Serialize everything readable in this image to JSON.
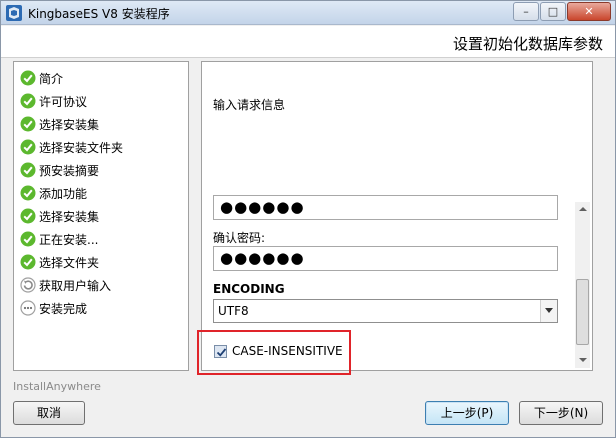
{
  "window": {
    "title": "KingbaseES V8 安装程序",
    "controls": {
      "minimize": "–",
      "maximize": "□",
      "close": "✕"
    }
  },
  "header": {
    "title": "设置初始化数据库参数"
  },
  "steps": [
    {
      "label": "简介",
      "status": "done"
    },
    {
      "label": "许可协议",
      "status": "done"
    },
    {
      "label": "选择安装集",
      "status": "done"
    },
    {
      "label": "选择安装文件夹",
      "status": "done"
    },
    {
      "label": "预安装摘要",
      "status": "done"
    },
    {
      "label": "添加功能",
      "status": "done"
    },
    {
      "label": "选择安装集",
      "status": "done"
    },
    {
      "label": "正在安装...",
      "status": "done"
    },
    {
      "label": "选择文件夹",
      "status": "done"
    },
    {
      "label": "获取用户输入",
      "status": "current"
    },
    {
      "label": "安装完成",
      "status": "pending"
    }
  ],
  "form": {
    "prompt": "输入请求信息",
    "password_mask": "●●●●●●",
    "confirm_label": "确认密码:",
    "confirm_mask": "●●●●●●",
    "encoding_label": "ENCODING",
    "encoding_value": "UTF8",
    "case_label": "CASE-INSENSITIVE",
    "case_checked": true
  },
  "footer": {
    "brand": "InstallAnywhere",
    "cancel": "取消",
    "previous": "上一步(P)",
    "next": "下一步(N)"
  },
  "colors": {
    "highlight": "#e0242a",
    "step_done": "#5cb82e",
    "step_current": "#9a9a9a"
  }
}
